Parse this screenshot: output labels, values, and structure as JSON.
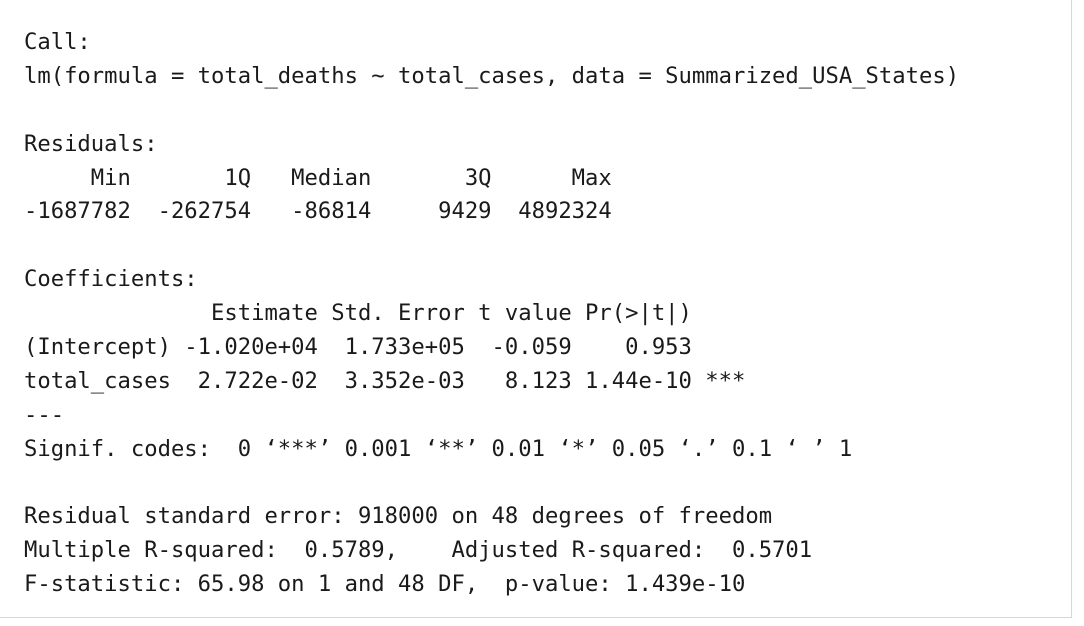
{
  "console": {
    "lines": [
      "Call:",
      "lm(formula = total_deaths ~ total_cases, data = Summarized_USA_States)",
      "",
      "Residuals:",
      "     Min       1Q   Median       3Q      Max ",
      "-1687782  -262754   -86814     9429  4892324 ",
      "",
      "Coefficients:",
      "              Estimate Std. Error t value Pr(>|t|)    ",
      "(Intercept) -1.020e+04  1.733e+05  -0.059    0.953    ",
      "total_cases  2.722e-02  3.352e-03   8.123 1.44e-10 ***",
      "---",
      "Signif. codes:  0 ‘***’ 0.001 ‘**’ 0.01 ‘*’ 0.05 ‘.’ 0.1 ‘ ’ 1",
      "",
      "Residual standard error: 918000 on 48 degrees of freedom",
      "Multiple R-squared:  0.5789,\tAdjusted R-squared:  0.5701 ",
      "F-statistic: 65.98 on 1 and 48 DF,  p-value: 1.439e-10"
    ]
  }
}
